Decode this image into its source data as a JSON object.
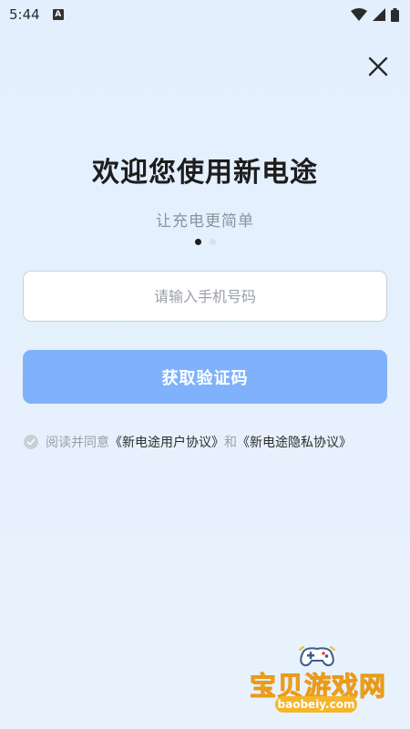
{
  "status_bar": {
    "time": "5:44",
    "notification_icon": "A",
    "icons": [
      "wifi-icon",
      "signal-icon",
      "battery-icon"
    ]
  },
  "header": {
    "close_icon": "close-icon"
  },
  "main": {
    "title": "欢迎您使用新电途",
    "subtitle": "让充电更简单",
    "page_indicator": {
      "total": 2,
      "active": 1
    },
    "phone_input": {
      "placeholder": "请输入手机号码",
      "value": ""
    },
    "get_code_button": "获取验证码",
    "agreement": {
      "checked": false,
      "prefix": "阅读并同意",
      "user_agreement": "《新电途用户协议》",
      "conjunction": "和",
      "privacy_policy": "《新电途隐私协议》"
    }
  },
  "watermark": {
    "text": "宝贝游戏网",
    "url": "baobeiy.com"
  },
  "colors": {
    "background": "#e4f0fd",
    "primary_button": "#7fb2fb",
    "title_text": "#1d1d1d",
    "secondary_text": "#8c939c",
    "watermark_yellow": "#f7c23a"
  }
}
